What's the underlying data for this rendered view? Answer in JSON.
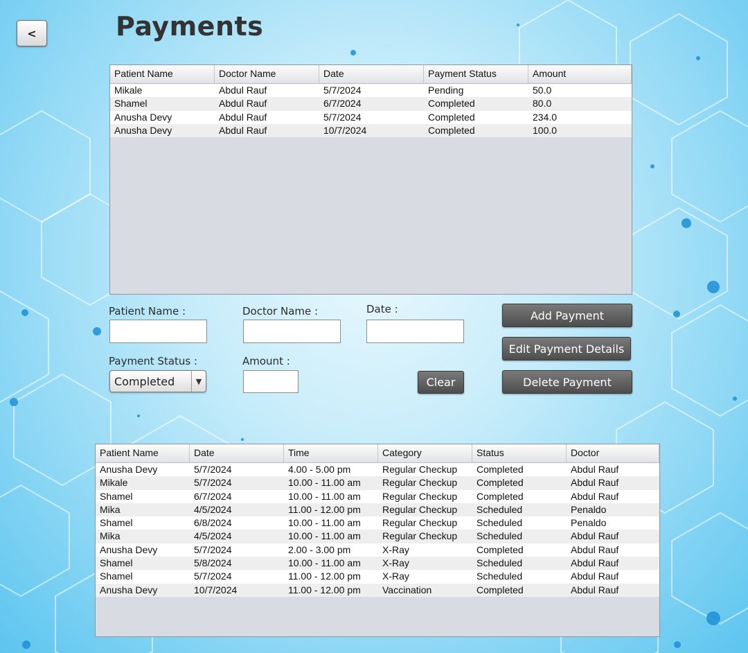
{
  "colors": {
    "accent_dark_button": "#5f5f5f",
    "background": "#9fdcf5",
    "table_empty": "#d8dbe1"
  },
  "nav": {
    "back_label": "<"
  },
  "page": {
    "title": "Payments"
  },
  "payments_table": {
    "columns": [
      "Patient Name",
      "Doctor Name",
      "Date",
      "Payment Status",
      "Amount"
    ],
    "rows": [
      [
        "Mikale",
        "Abdul Rauf",
        "5/7/2024",
        "Pending",
        "50.0"
      ],
      [
        "Shamel",
        "Abdul Rauf",
        "6/7/2024",
        "Completed",
        "80.0"
      ],
      [
        "Anusha Devy",
        "Abdul Rauf",
        "5/7/2024",
        "Completed",
        "234.0"
      ],
      [
        "Anusha Devy",
        "Abdul Rauf",
        "10/7/2024",
        "Completed",
        "100.0"
      ]
    ]
  },
  "form": {
    "patient_name_label": "Patient Name :",
    "patient_name_value": "",
    "doctor_name_label": "Doctor Name :",
    "doctor_name_value": "",
    "date_label": "Date :",
    "date_value": "",
    "payment_status_label": "Payment Status :",
    "payment_status_value": "Completed",
    "amount_label": "Amount :",
    "amount_value": ""
  },
  "buttons": {
    "add": "Add Payment",
    "edit": "Edit Payment Details",
    "delete": "Delete Payment",
    "clear": "Clear"
  },
  "appointments_table": {
    "columns": [
      "Patient Name",
      "Date",
      "Time",
      "Category",
      "Status",
      "Doctor"
    ],
    "rows": [
      [
        "Anusha Devy",
        "5/7/2024",
        "4.00 - 5.00 pm",
        "Regular Checkup",
        "Completed",
        "Abdul Rauf"
      ],
      [
        "Mikale",
        "5/7/2024",
        "10.00 - 11.00 am",
        "Regular Checkup",
        "Completed",
        "Abdul Rauf"
      ],
      [
        "Shamel",
        "6/7/2024",
        "10.00 - 11.00 am",
        "Regular Checkup",
        "Completed",
        "Abdul Rauf"
      ],
      [
        "Mika",
        "4/5/2024",
        "11.00 - 12.00 pm",
        "Regular Checkup",
        "Scheduled",
        "Penaldo"
      ],
      [
        "Shamel",
        "6/8/2024",
        "10.00 - 11.00 am",
        "Regular Checkup",
        "Scheduled",
        "Penaldo"
      ],
      [
        "Mika",
        "4/5/2024",
        "10.00 - 11.00 am",
        "Regular Checkup",
        "Scheduled",
        "Abdul Rauf"
      ],
      [
        "Anusha Devy",
        "5/7/2024",
        "2.00 - 3.00 pm",
        "X-Ray",
        "Completed",
        "Abdul Rauf"
      ],
      [
        "Shamel",
        "5/8/2024",
        "10.00 - 11.00 am",
        "X-Ray",
        "Scheduled",
        "Abdul Rauf"
      ],
      [
        "Shamel",
        "5/7/2024",
        "11.00 - 12.00 pm",
        "X-Ray",
        "Scheduled",
        "Abdul Rauf"
      ],
      [
        "Anusha Devy",
        "10/7/2024",
        "11.00 - 12.00 pm",
        "Vaccination",
        "Completed",
        "Abdul Rauf"
      ]
    ]
  }
}
